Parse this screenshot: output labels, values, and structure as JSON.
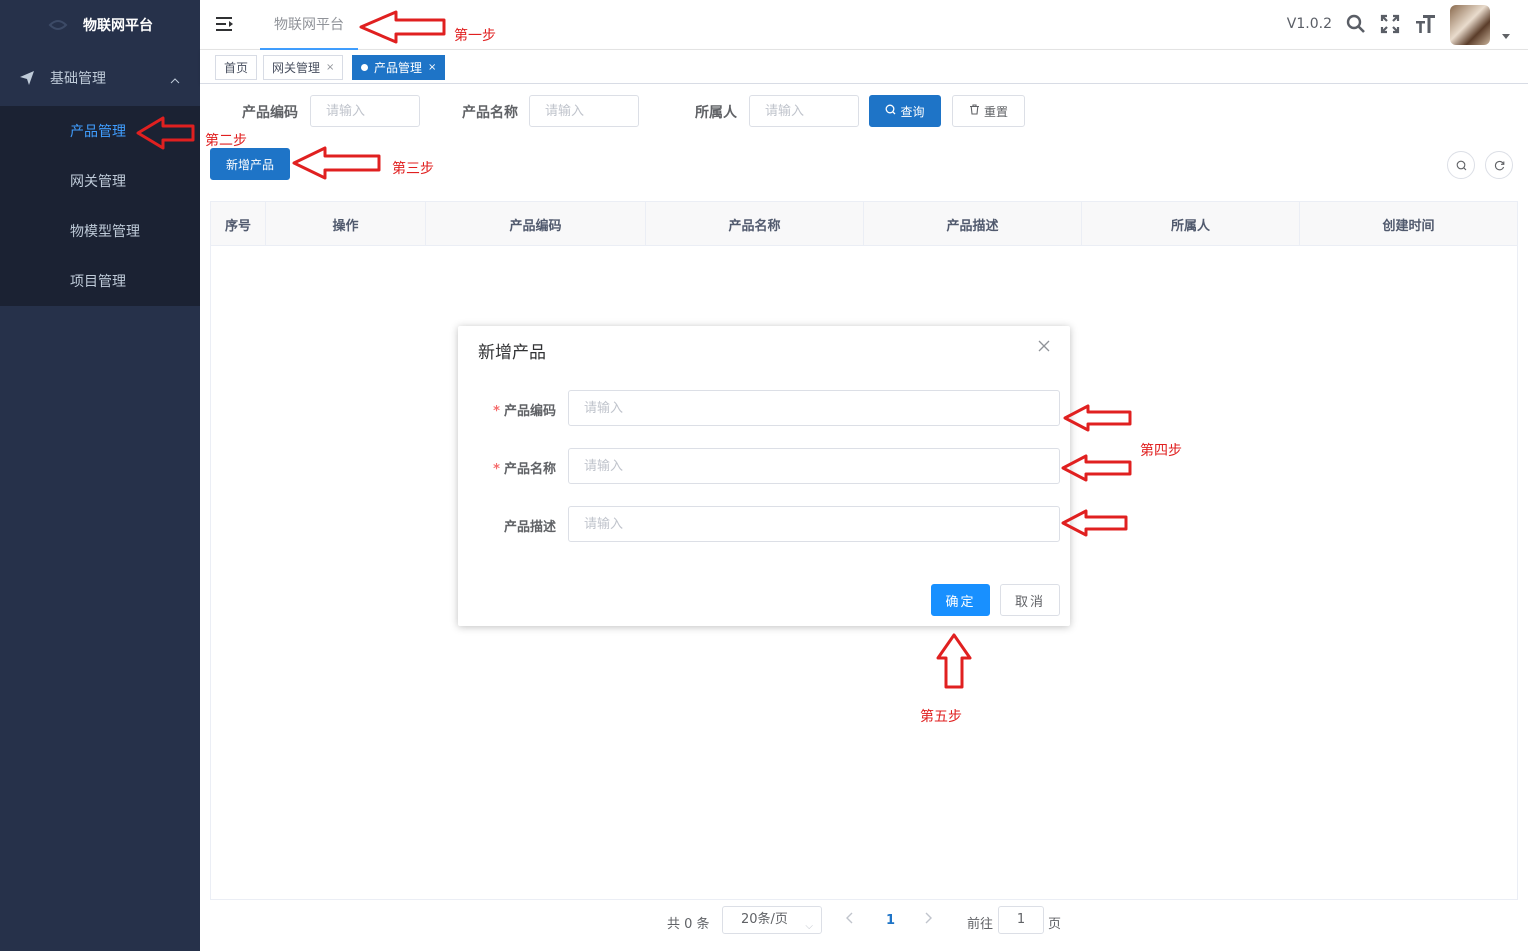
{
  "brand": {
    "title": "物联网平台"
  },
  "sidebar": {
    "group_label": "基础管理",
    "items": [
      {
        "label": "产品管理",
        "active": true
      },
      {
        "label": "网关管理",
        "active": false
      },
      {
        "label": "物模型管理",
        "active": false
      },
      {
        "label": "项目管理",
        "active": false
      }
    ]
  },
  "header": {
    "top_tab": "物联网平台",
    "version": "V1.0.2",
    "icons": [
      "search-icon",
      "fullscreen-icon",
      "font-size-icon"
    ]
  },
  "tags": {
    "home": "首页",
    "gateway": "网关管理",
    "product": "产品管理",
    "close_glyph": "×"
  },
  "filter": {
    "code_label": "产品编码",
    "name_label": "产品名称",
    "owner_label": "所属人",
    "placeholder": "请输入",
    "search_btn": "查询",
    "reset_btn": "重置"
  },
  "toolbar": {
    "add_btn": "新增产品"
  },
  "table": {
    "columns": [
      "序号",
      "操作",
      "产品编码",
      "产品名称",
      "产品描述",
      "所属人",
      "创建时间"
    ],
    "rows": []
  },
  "pagination": {
    "total_text": "共 0 条",
    "page_size": "20条/页",
    "current_page": "1",
    "goto_label": "前往",
    "goto_value": "1",
    "page_suffix": "页"
  },
  "dialog": {
    "title": "新增产品",
    "fields": [
      {
        "label": "产品编码",
        "required": true,
        "placeholder": "请输入"
      },
      {
        "label": "产品名称",
        "required": true,
        "placeholder": "请输入"
      },
      {
        "label": "产品描述",
        "required": false,
        "placeholder": "请输入"
      }
    ],
    "required_mark": "*",
    "ok_btn": "确定",
    "cancel_btn": "取消"
  },
  "annotations": {
    "step1": "第一步",
    "step2": "第二步",
    "step3": "第三步",
    "step4": "第四步",
    "step5": "第五步",
    "color": "#e02020"
  },
  "colors": {
    "sidebar_bg": "#26314a",
    "submenu_bg": "#1b2233",
    "primary": "#1e74c7",
    "dialog_ok": "#1890ff"
  }
}
